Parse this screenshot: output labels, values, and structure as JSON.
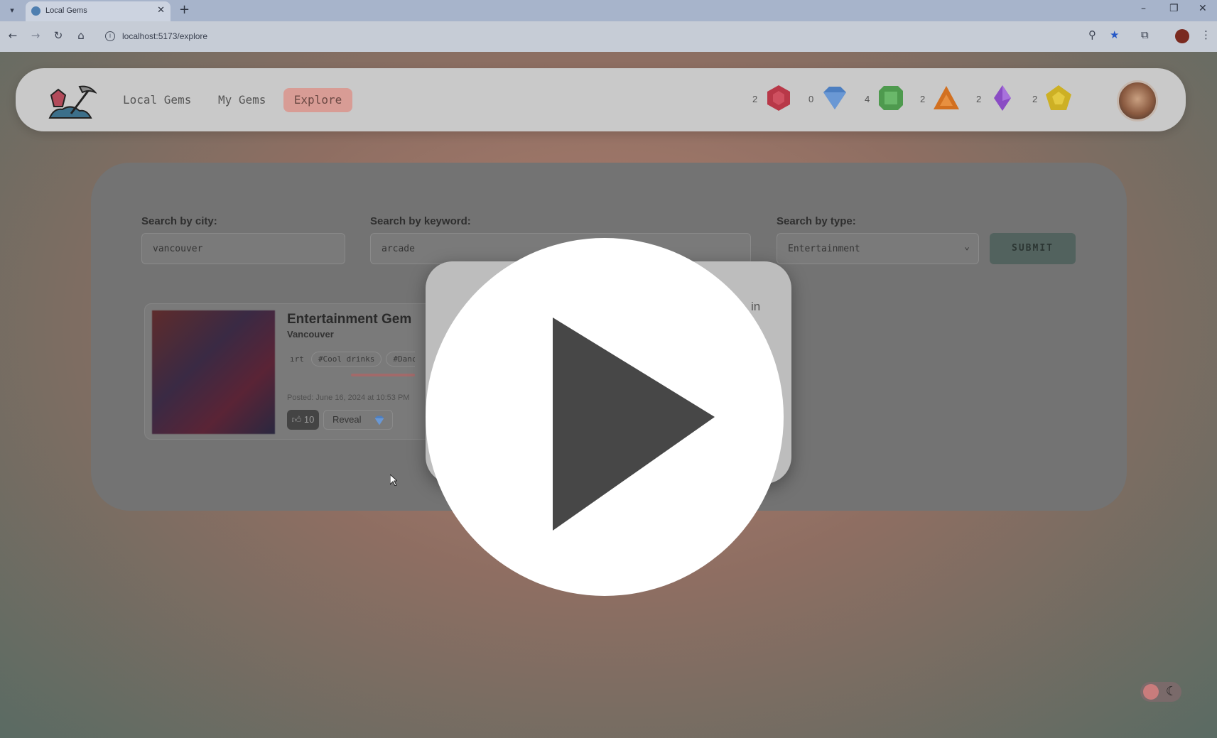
{
  "browser": {
    "tab_title": "Local Gems",
    "tab_close": "✕",
    "new_tab": "+",
    "url": "localhost:5173/explore",
    "window_controls": [
      "–",
      "❐",
      "✕"
    ]
  },
  "nav": {
    "links": [
      "Local Gems",
      "My Gems"
    ],
    "active_link": "Explore",
    "gems": [
      {
        "count": "2",
        "icon": "red-hexagon-gem-icon",
        "color": "#d43a4a"
      },
      {
        "count": "0",
        "icon": "blue-diamond-gem-icon",
        "color": "#4a8bd6"
      },
      {
        "count": "4",
        "icon": "green-square-gem-icon",
        "color": "#5cb85c"
      },
      {
        "count": "2",
        "icon": "orange-triangle-gem-icon",
        "color": "#e8822a"
      },
      {
        "count": "2",
        "icon": "purple-crystal-gem-icon",
        "color": "#9a5ad6"
      },
      {
        "count": "2",
        "icon": "yellow-pentagon-gem-icon",
        "color": "#e6c820"
      }
    ]
  },
  "search": {
    "city_label": "Search by city:",
    "city_value": "vancouver",
    "keyword_label": "Search by keyword:",
    "keyword_value": "arcade",
    "type_label": "Search by type:",
    "type_value": "Entertainment",
    "submit_label": "SUBMIT"
  },
  "result": {
    "title": "Entertainment Gem",
    "city": "Vancouver",
    "tags": [
      "ırt",
      "#Cool drinks",
      "#Danci"
    ],
    "posted": "Posted: June 16, 2024 at 10:53 PM",
    "likes": "10",
    "reveal_label": "Reveal"
  },
  "modal": {
    "fragments": [
      "in",
      "n"
    ]
  },
  "colors": {
    "accent_explore": "#d89c95",
    "submit": "#52625e",
    "overlay_play": "#ffffff"
  }
}
